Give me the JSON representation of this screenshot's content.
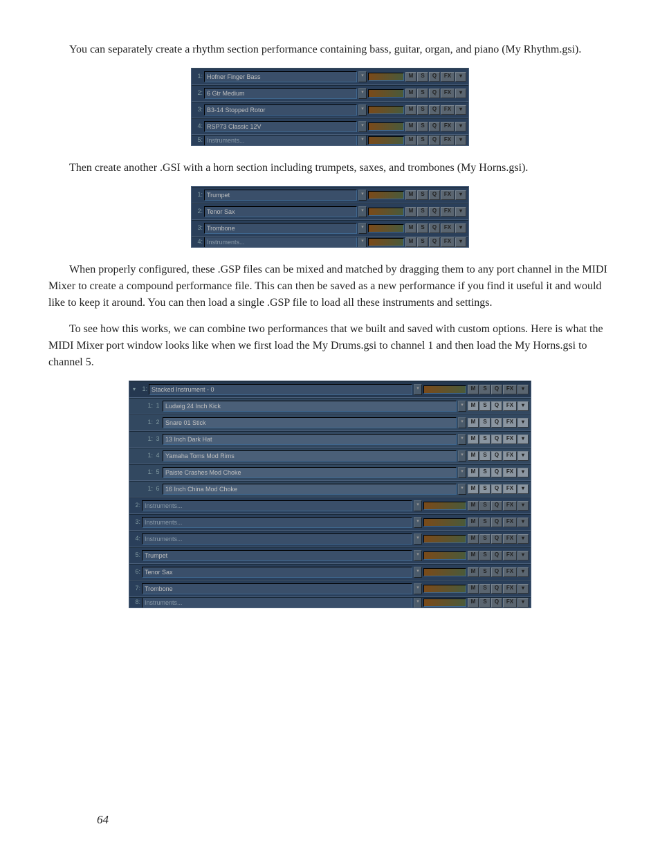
{
  "paragraphs": {
    "p1": "You can separately create a rhythm section performance containing bass, guitar, organ, and piano (My Rhythm.gsi).",
    "p2": "Then create another .GSI with a horn section including trumpets, saxes, and trombones (My Horns.gsi).",
    "p3": "When properly configured, these .GSP files can be mixed and matched by dragging them to any port channel in the MIDI Mixer to create a compound performance file. This can then be saved as a new performance if you find it useful it and would like to keep it around. You can then load a single .GSP file to load all these instruments and settings.",
    "p4": "To see how this works, we can combine two performances that we built and saved with custom options. Here is what the MIDI Mixer port window looks like when we first load the My Drums.gsi to channel 1 and then load the My Horns.gsi to channel 5."
  },
  "buttons": {
    "m": "M",
    "s": "S",
    "q": "Q",
    "fx": "FX",
    "dd": "▾"
  },
  "panel1": {
    "tracks": [
      {
        "num": "1:",
        "name": "Hofner Finger Bass"
      },
      {
        "num": "2:",
        "name": "6 Gtr Medium"
      },
      {
        "num": "3:",
        "name": "B3-14 Stopped Rotor"
      },
      {
        "num": "4:",
        "name": "RSP73 Classic 12V"
      },
      {
        "num": "5:",
        "name": "Instruments..."
      }
    ]
  },
  "panel2": {
    "tracks": [
      {
        "num": "1:",
        "name": "Trumpet"
      },
      {
        "num": "2:",
        "name": "Tenor Sax"
      },
      {
        "num": "3:",
        "name": "Trombone"
      },
      {
        "num": "4:",
        "name": "Instruments..."
      }
    ]
  },
  "panel3": {
    "header": {
      "num": "1:",
      "name": "Stacked Instrument - 0"
    },
    "subs": [
      {
        "pre": "1:",
        "sub": "1",
        "name": "Ludwig 24 Inch Kick"
      },
      {
        "pre": "1:",
        "sub": "2",
        "name": "Snare 01 Stick"
      },
      {
        "pre": "1:",
        "sub": "3",
        "name": "13 Inch Dark Hat"
      },
      {
        "pre": "1:",
        "sub": "4",
        "name": "Yamaha Toms Mod Rims"
      },
      {
        "pre": "1:",
        "sub": "5",
        "name": "Paiste Crashes Mod Choke"
      },
      {
        "pre": "1:",
        "sub": "6",
        "name": "16 Inch China Mod Choke"
      }
    ],
    "tracks": [
      {
        "num": "2:",
        "name": "Instruments..."
      },
      {
        "num": "3:",
        "name": "Instruments..."
      },
      {
        "num": "4:",
        "name": "Instruments..."
      },
      {
        "num": "5:",
        "name": "Trumpet"
      },
      {
        "num": "6:",
        "name": "Tenor Sax"
      },
      {
        "num": "7:",
        "name": "Trombone"
      },
      {
        "num": "8:",
        "name": "Instruments..."
      }
    ]
  },
  "page_number": "64"
}
